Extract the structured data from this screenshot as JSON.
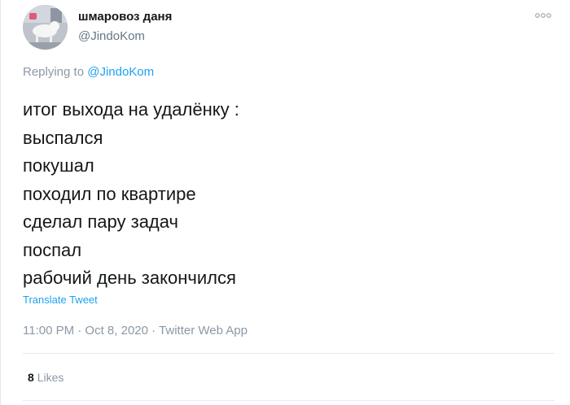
{
  "tweet": {
    "author_name": "шмаровоз даня",
    "author_handle": "@JindoKom",
    "more_icon": "more-options-icon",
    "replying_prefix": "Replying to",
    "replying_handle": "@JindoKom",
    "lines": [
      "итог выхода на удалёнку :",
      "выспался",
      "покушал",
      "походил по квартире",
      "сделал пару задач",
      "поспал",
      "рабочий день закончился"
    ],
    "translate_label": "Translate Tweet",
    "timestamp": "11:00 PM · Oct 8, 2020 · Twitter Web App",
    "likes_count": "8",
    "likes_label": "Likes"
  },
  "colors": {
    "text": "#14171a",
    "secondary": "#8b98a5",
    "link": "#1da1f2",
    "divider": "#e6ecf0"
  }
}
